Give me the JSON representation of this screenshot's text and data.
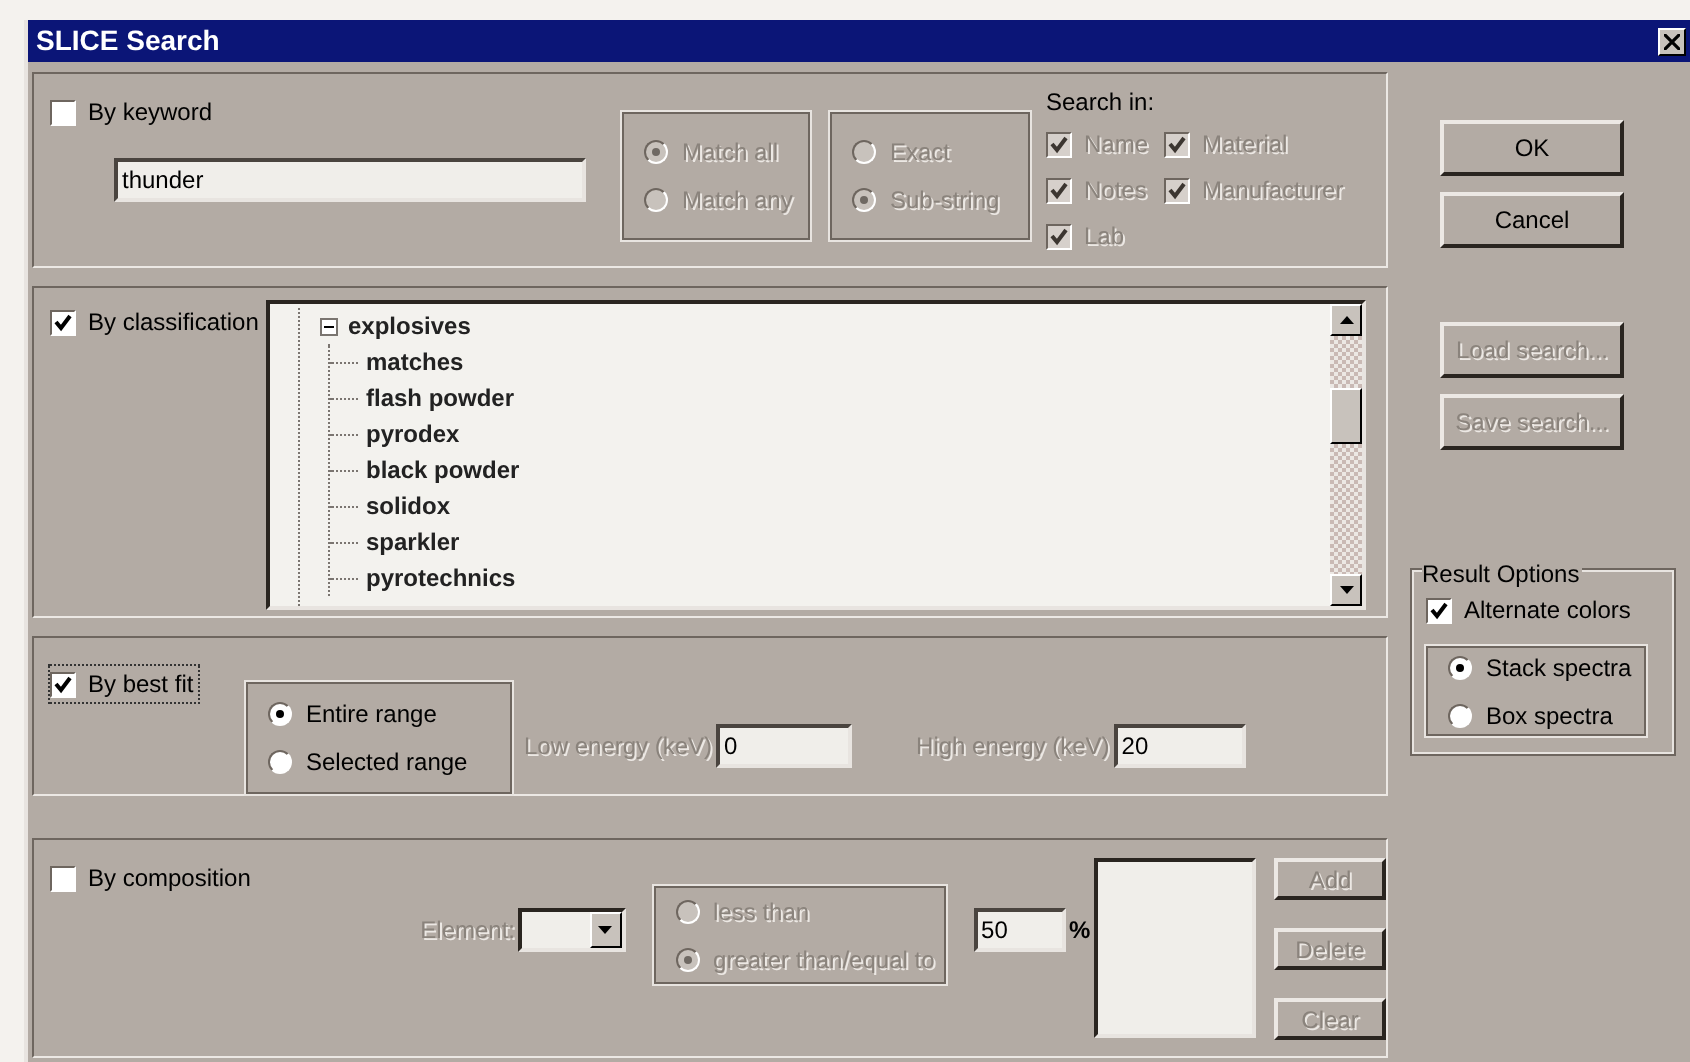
{
  "window": {
    "title": "SLICE Search"
  },
  "keyword": {
    "label": "By keyword",
    "checked": false,
    "value": "thunder",
    "match": [
      {
        "label": "Match all",
        "selected": true,
        "disabled": true
      },
      {
        "label": "Match any",
        "selected": false,
        "disabled": true
      }
    ],
    "mode": [
      {
        "label": "Exact",
        "selected": false,
        "disabled": true
      },
      {
        "label": "Sub-string",
        "selected": true,
        "disabled": true
      }
    ],
    "search_in": {
      "label": "Search in:",
      "options": [
        {
          "label": "Name",
          "checked": true,
          "disabled": true
        },
        {
          "label": "Material",
          "checked": true,
          "disabled": true
        },
        {
          "label": "Notes",
          "checked": true,
          "disabled": true
        },
        {
          "label": "Manufacturer",
          "checked": true,
          "disabled": true
        },
        {
          "label": "Lab",
          "checked": true,
          "disabled": true
        }
      ]
    }
  },
  "classification": {
    "label": "By classification",
    "checked": true,
    "tree": [
      {
        "label": "explosives",
        "expanded": true,
        "children": [
          {
            "label": "matches"
          },
          {
            "label": "flash powder"
          },
          {
            "label": "pyrodex"
          },
          {
            "label": "black powder"
          },
          {
            "label": "solidox"
          },
          {
            "label": "sparkler"
          },
          {
            "label": "pyrotechnics"
          }
        ]
      }
    ]
  },
  "best_fit": {
    "label": "By best fit",
    "checked": true,
    "ranges": [
      {
        "label": "Entire range",
        "selected": true
      },
      {
        "label": "Selected range",
        "selected": false
      }
    ],
    "low": {
      "label": "Low energy (keV)",
      "value": "0",
      "disabled": true
    },
    "high": {
      "label": "High energy (keV)",
      "value": "20",
      "disabled": true
    }
  },
  "composition": {
    "label": "By composition",
    "checked": false,
    "element": {
      "label": "Element:",
      "disabled": true
    },
    "comparison": [
      {
        "label": "less than",
        "selected": false,
        "disabled": true
      },
      {
        "label": "greater than/equal to",
        "selected": true,
        "disabled": true
      }
    ],
    "percent": {
      "value": "50",
      "unit": "%"
    },
    "buttons": [
      {
        "label": "Add",
        "disabled": true
      },
      {
        "label": "Delete",
        "disabled": true
      },
      {
        "label": "Clear",
        "disabled": true
      }
    ]
  },
  "buttons": [
    {
      "label": "OK",
      "disabled": false
    },
    {
      "label": "Cancel",
      "disabled": false
    },
    {
      "label": "Load search...",
      "disabled": true
    },
    {
      "label": "Save search...",
      "disabled": true
    }
  ],
  "result_options": {
    "title": "Result Options",
    "alternate": {
      "label": "Alternate colors",
      "checked": true
    },
    "layout": [
      {
        "label": "Stack spectra",
        "selected": true
      },
      {
        "label": "Box spectra",
        "selected": false
      }
    ]
  }
}
